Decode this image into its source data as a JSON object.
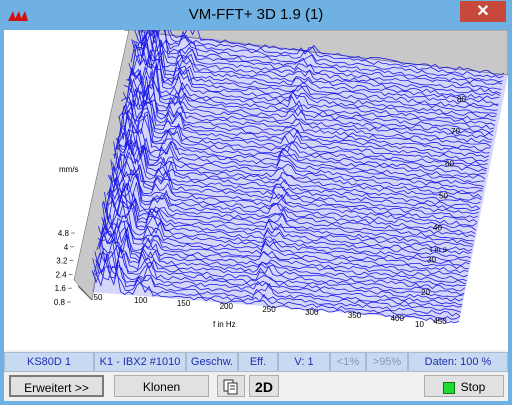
{
  "window": {
    "title": "VM-FFT+ 3D 1.9 (1)",
    "close_glyph": "✕",
    "accent": "#6fb1e3"
  },
  "plot": {
    "line_color": "#1a1ae6",
    "unit_label": "mm/s",
    "freq_axis_label": "f in Hz",
    "time_axis_label": "t in s",
    "amp_ticks": [
      "4.8",
      "4",
      "3.2",
      "2.4",
      "1.6",
      "0.8"
    ],
    "freq_ticks": [
      "50",
      "100",
      "150",
      "200",
      "250",
      "300",
      "350",
      "400",
      "450"
    ],
    "time_ticks": [
      "80",
      "70",
      "60",
      "50",
      "40",
      "30",
      "20",
      "10"
    ]
  },
  "status": {
    "device": "KS80D 1",
    "channel": "K1 - IBX2 #1010",
    "quantity": "Geschw.",
    "mode": "Eff.",
    "v": "V: 1",
    "low": "<1%",
    "high": ">95%",
    "data": "Daten: 100 %"
  },
  "toolbar": {
    "advanced_label": "Erweitert >>",
    "clone_label": "Klonen",
    "copy_icon": "copy-icon",
    "twod_label": "2D",
    "stop_label": "Stop"
  },
  "colors": {
    "status_bg": "#c8daf2",
    "status_text": "#1e2fb0",
    "led": "#1edc32"
  }
}
